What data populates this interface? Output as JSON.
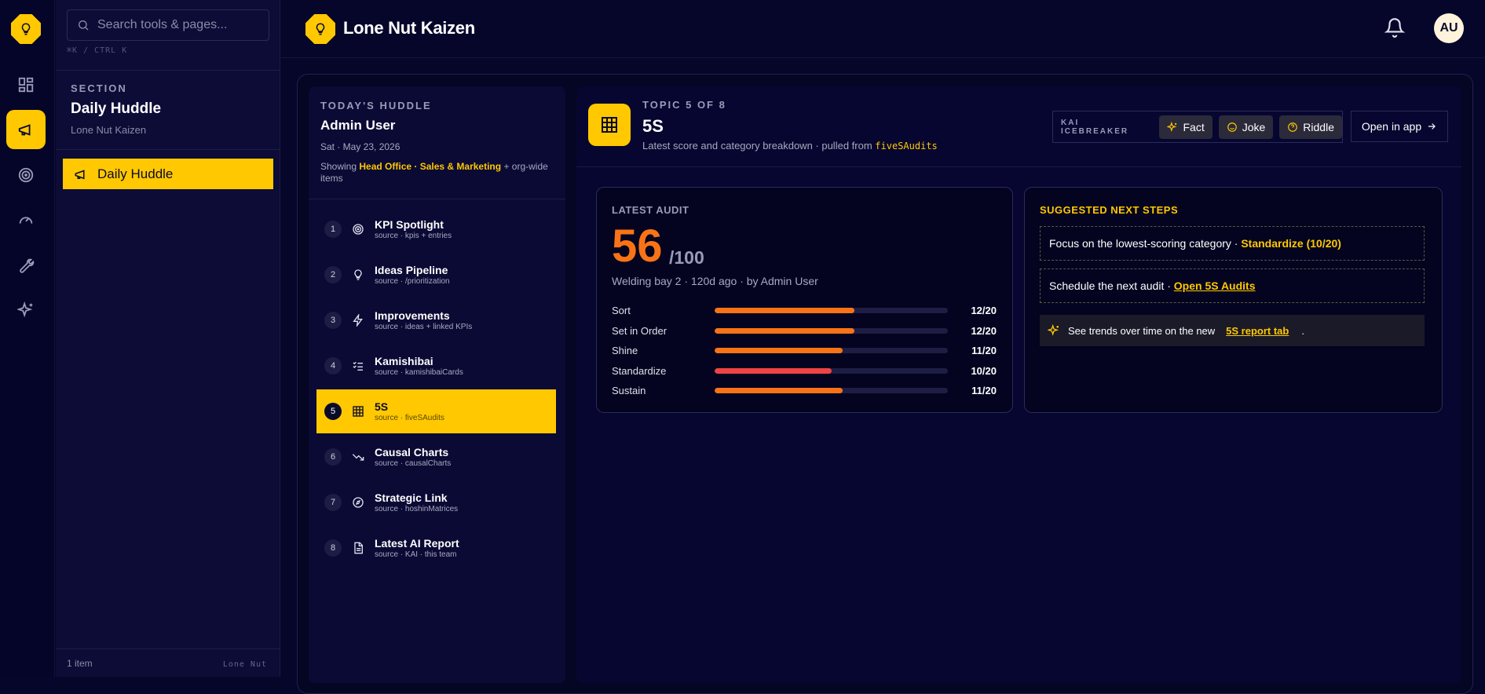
{
  "sidebar": {
    "search_placeholder": "Search tools & pages...",
    "shortcut": "⌘K / CTRL K",
    "section_label": "SECTION",
    "section_title": "Daily Huddle",
    "section_subtitle": "Lone Nut Kaizen",
    "nav_items": [
      {
        "label": "Daily Huddle"
      }
    ],
    "footer_count": "1 item",
    "footer_brand": "Lone Nut"
  },
  "header": {
    "brand": "Lone Nut Kaizen",
    "avatar_initials": "AU"
  },
  "huddle": {
    "label": "TODAY'S HUDDLE",
    "user": "Admin User",
    "date": "Sat · May 23, 2026",
    "showing_prefix": "Showing",
    "showing_scope": "Head Office · Sales & Marketing",
    "showing_suffix": "+ org-wide items",
    "topics": [
      {
        "num": "1",
        "title": "KPI Spotlight",
        "source": "source · kpis + entries",
        "icon": "target-icon"
      },
      {
        "num": "2",
        "title": "Ideas Pipeline",
        "source": "source · /prioritization",
        "icon": "lightbulb-icon"
      },
      {
        "num": "3",
        "title": "Improvements",
        "source": "source · ideas + linked KPIs",
        "icon": "lightning-icon"
      },
      {
        "num": "4",
        "title": "Kamishibai",
        "source": "source · kamishibaiCards",
        "icon": "checklist-icon"
      },
      {
        "num": "5",
        "title": "5S",
        "source": "source · fiveSAudits",
        "icon": "grid-icon"
      },
      {
        "num": "6",
        "title": "Causal Charts",
        "source": "source · causalCharts",
        "icon": "trend-down-icon"
      },
      {
        "num": "7",
        "title": "Strategic Link",
        "source": "source · hoshinMatrices",
        "icon": "compass-icon"
      },
      {
        "num": "8",
        "title": "Latest AI Report",
        "source": "source · KAI · this team",
        "icon": "document-icon"
      }
    ]
  },
  "topic": {
    "label": "TOPIC 5 OF 8",
    "title": "5S",
    "subtitle": "Latest score and category breakdown · pulled from",
    "source_code": "fiveSAudits",
    "icebreaker_label": "KAI ICEBREAKER",
    "chips": [
      {
        "label": "Fact"
      },
      {
        "label": "Joke"
      },
      {
        "label": "Riddle"
      }
    ],
    "open_app": "Open in app"
  },
  "audit": {
    "label": "LATEST AUDIT",
    "score": "56",
    "score_max": "/100",
    "meta": "Welding bay 2 · 120d ago · by Admin User",
    "categories": [
      {
        "name": "Sort",
        "value": "12/20",
        "fraction": 0.6,
        "color": "#f97316"
      },
      {
        "name": "Set in Order",
        "value": "12/20",
        "fraction": 0.6,
        "color": "#f97316"
      },
      {
        "name": "Shine",
        "value": "11/20",
        "fraction": 0.55,
        "color": "#f97316"
      },
      {
        "name": "Standardize",
        "value": "10/20",
        "fraction": 0.5,
        "color": "#ef4444"
      },
      {
        "name": "Sustain",
        "value": "11/20",
        "fraction": 0.55,
        "color": "#f97316"
      }
    ]
  },
  "next_steps": {
    "label": "SUGGESTED NEXT STEPS",
    "step1_text": "Focus on the lowest-scoring category ·",
    "step1_highlight": "Standardize (10/20)",
    "step2_text": "Schedule the next audit ·",
    "step2_link": "Open 5S Audits",
    "tip_text": "See trends over time on the new",
    "tip_link": "5S report tab",
    "tip_end": "."
  },
  "colors": {
    "accent": "#ffc800",
    "score": "#f97316",
    "low": "#ef4444",
    "background": "#06062a"
  }
}
